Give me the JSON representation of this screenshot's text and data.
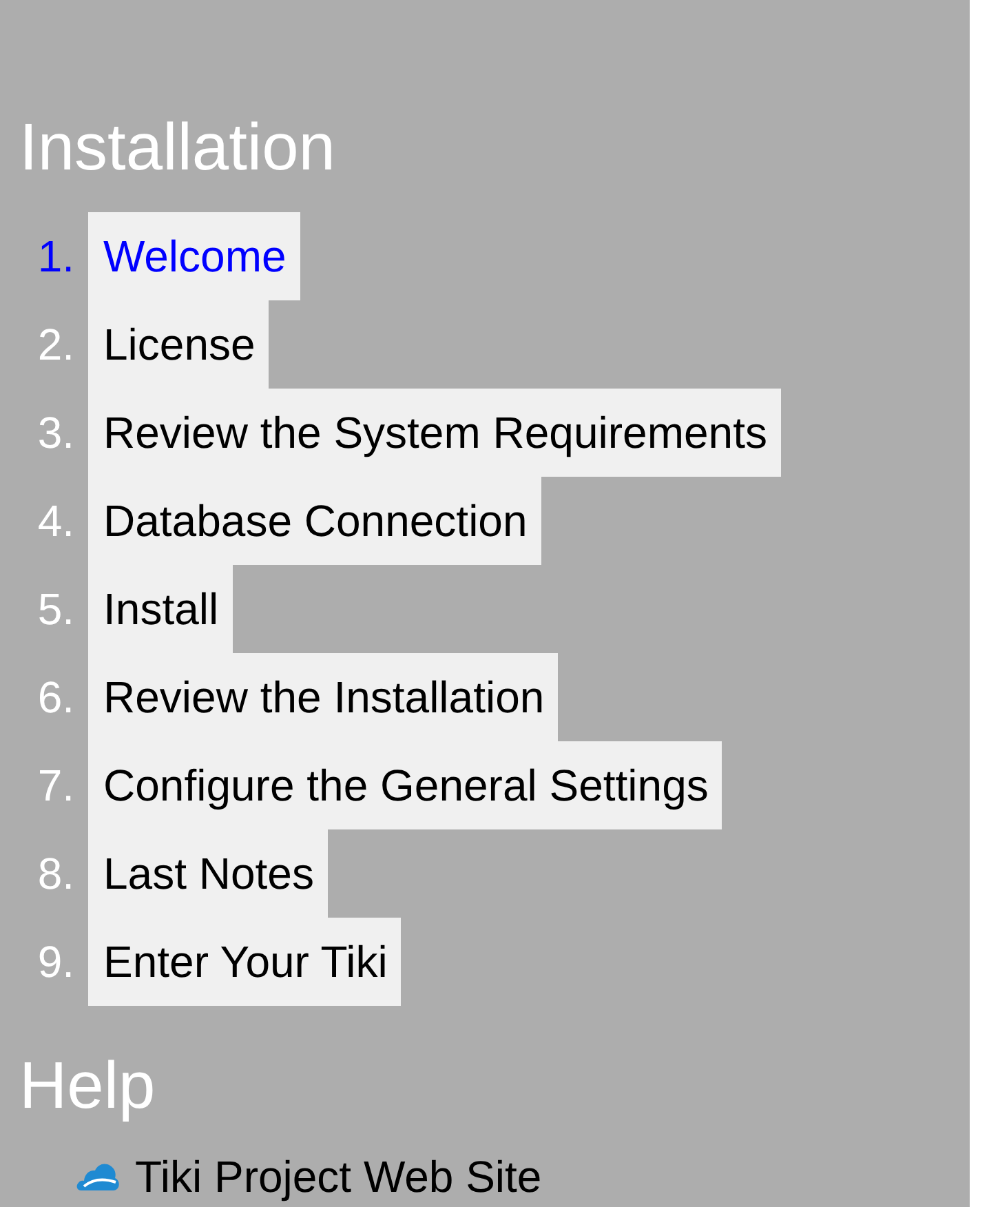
{
  "installation": {
    "heading": "Installation",
    "steps": [
      {
        "number": "1.",
        "label": "Welcome",
        "selected": true
      },
      {
        "number": "2.",
        "label": "License",
        "selected": false
      },
      {
        "number": "3.",
        "label": "Review the System Requirements",
        "selected": false
      },
      {
        "number": "4.",
        "label": "Database Connection",
        "selected": false
      },
      {
        "number": "5.",
        "label": "Install",
        "selected": false
      },
      {
        "number": "6.",
        "label": "Review the Installation",
        "selected": false
      },
      {
        "number": "7.",
        "label": "Configure the General Settings",
        "selected": false
      },
      {
        "number": "8.",
        "label": "Last Notes",
        "selected": false
      },
      {
        "number": "9.",
        "label": "Enter Your Tiki",
        "selected": false
      }
    ]
  },
  "help": {
    "heading": "Help",
    "links": [
      {
        "label": "Tiki Project Web Site"
      }
    ]
  }
}
